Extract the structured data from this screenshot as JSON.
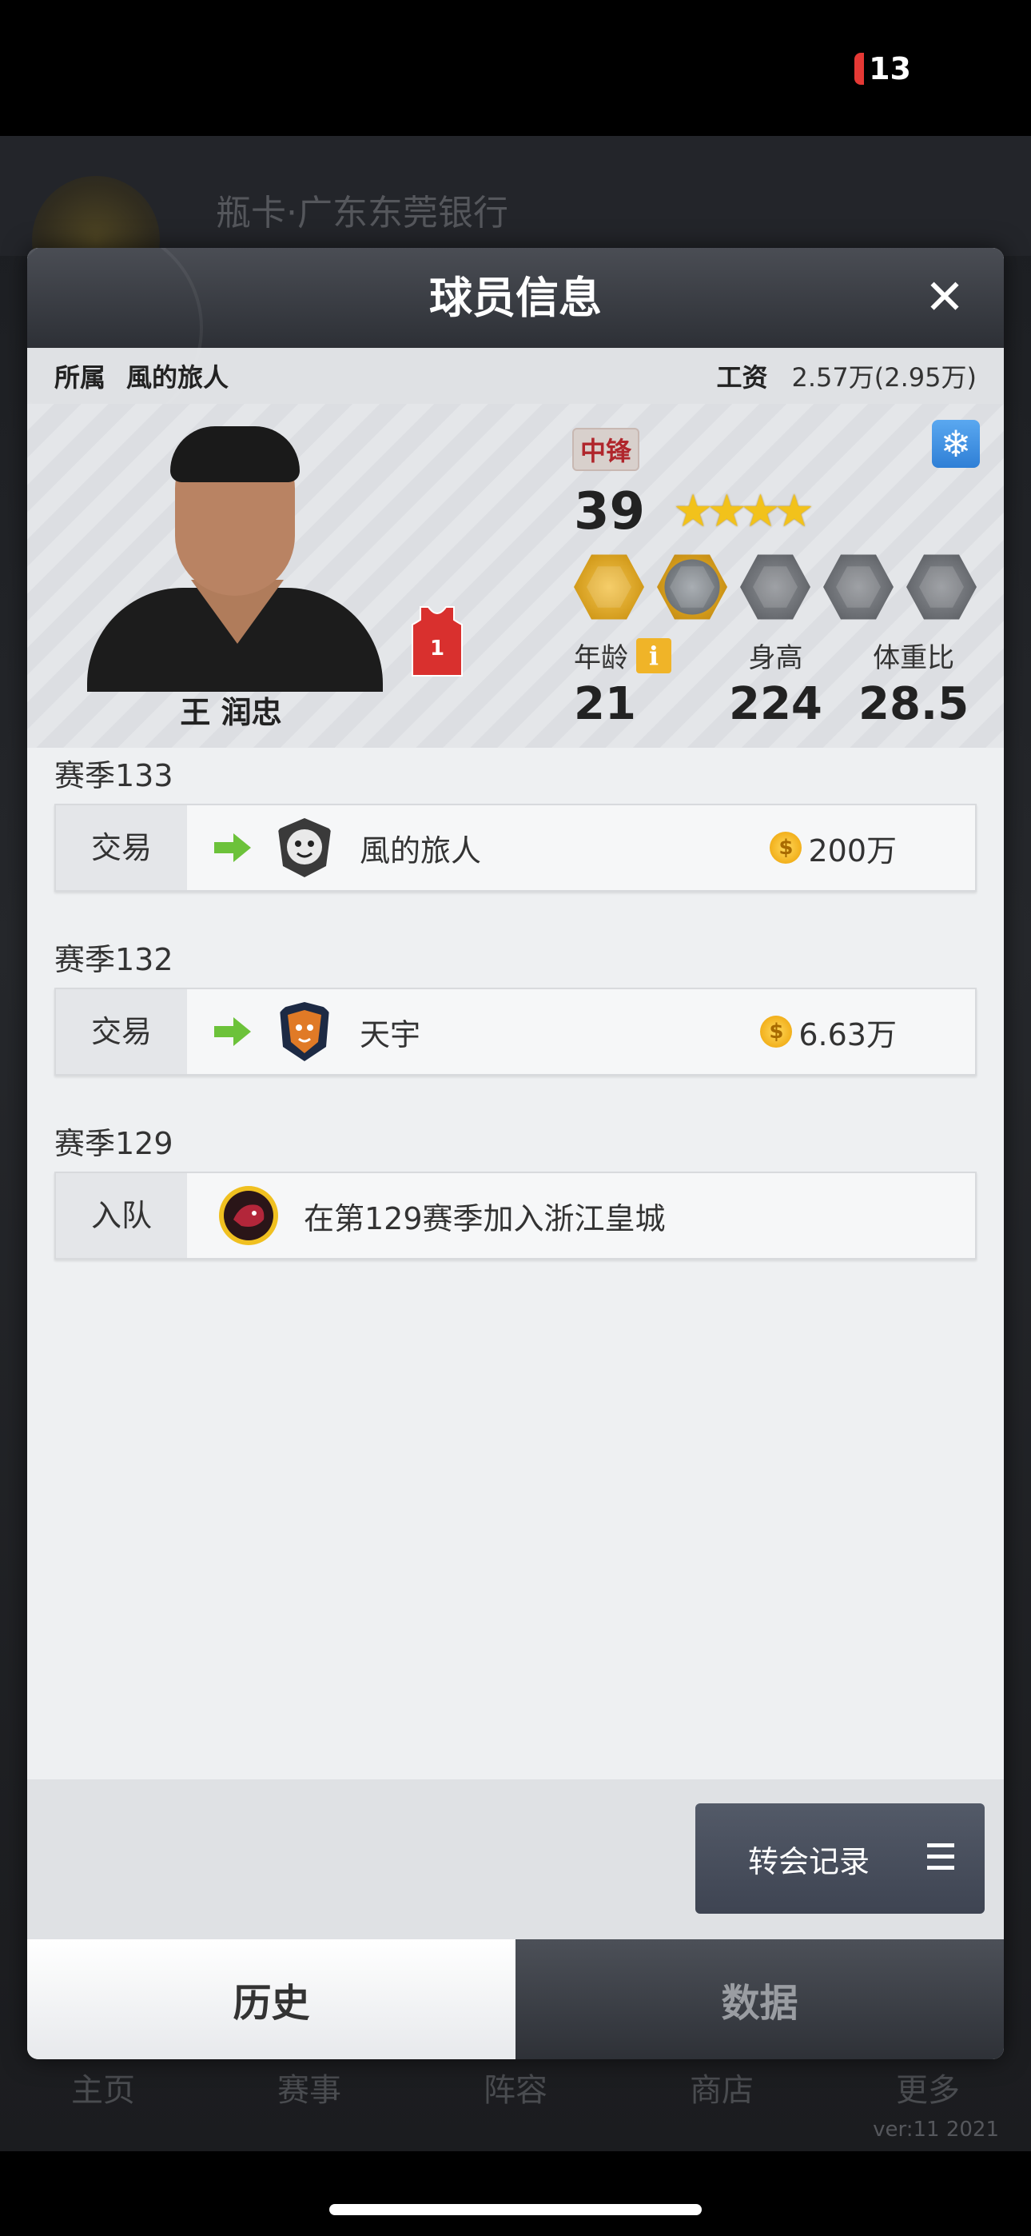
{
  "status": {
    "battery": "13"
  },
  "background": {
    "title": "瓶卡·广东东莞银行",
    "nav": [
      "主页",
      "赛事",
      "阵容",
      "商店",
      "更多"
    ],
    "version": "ver:11  2021"
  },
  "modal": {
    "title": "球员信息",
    "info": {
      "team_label": "所属",
      "team_value": "風的旅人",
      "salary_label": "工资",
      "salary_value": "2.57万(2.95万)"
    },
    "player": {
      "name": "王 润忠",
      "jersey_number": "1",
      "position": "中锋",
      "rating": "39",
      "stars": 4,
      "stats": [
        {
          "label": "年龄",
          "value": "21"
        },
        {
          "label": "身高",
          "value": "224"
        },
        {
          "label": "体重比",
          "value": "28.5"
        }
      ]
    },
    "history": [
      {
        "season": "赛季133",
        "type": "交易",
        "team": "風的旅人",
        "fee": "200万"
      },
      {
        "season": "赛季132",
        "type": "交易",
        "team": "天宇",
        "fee": "6.63万"
      },
      {
        "season": "赛季129",
        "type": "入队",
        "text": "在第129赛季加入浙江皇城"
      }
    ],
    "transfer_button": "转会记录",
    "tabs": [
      {
        "label": "历史",
        "active": true
      },
      {
        "label": "数据",
        "active": false
      }
    ]
  },
  "colors": {
    "accent_gold": "#f2c21b",
    "position_red": "#b0262c",
    "arrow_green": "#6cc23a"
  }
}
